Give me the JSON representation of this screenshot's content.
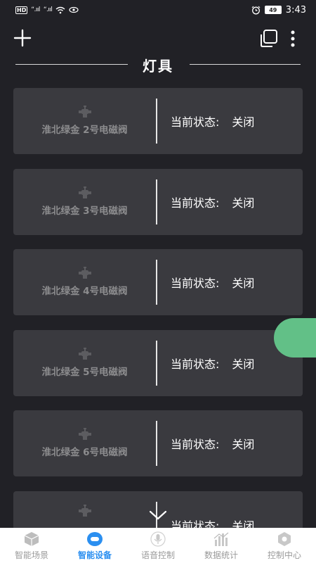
{
  "status_bar": {
    "hd_label": "HD",
    "sim1": "“.ııl",
    "sim2": "“.ııl",
    "battery": "49",
    "time": "3:43"
  },
  "header": {
    "section_title": "灯具"
  },
  "devices": [
    {
      "name": "淮北绿金 2号电磁阀",
      "status_label": "当前状态:",
      "status_value": "关闭"
    },
    {
      "name": "淮北绿金 3号电磁阀",
      "status_label": "当前状态:",
      "status_value": "关闭"
    },
    {
      "name": "淮北绿金 4号电磁阀",
      "status_label": "当前状态:",
      "status_value": "关闭"
    },
    {
      "name": "淮北绿金 5号电磁阀",
      "status_label": "当前状态:",
      "status_value": "关闭"
    },
    {
      "name": "淮北绿金 6号电磁阀",
      "status_label": "当前状态:",
      "status_value": "关闭"
    },
    {
      "name": "",
      "status_label": "当前状态:",
      "status_value": "关闭"
    }
  ],
  "bottom_nav": [
    {
      "label": "智能场景",
      "icon": "cube-icon",
      "active": false
    },
    {
      "label": "智能设备",
      "icon": "device-icon",
      "active": true
    },
    {
      "label": "语音控制",
      "icon": "microphone-icon",
      "active": false
    },
    {
      "label": "数据统计",
      "icon": "chart-icon",
      "active": false
    },
    {
      "label": "控制中心",
      "icon": "hexagon-icon",
      "active": false
    }
  ],
  "colors": {
    "background": "#212126",
    "card": "#3a3a3f",
    "accent": "#2b8ff0",
    "fab": "#62c087"
  }
}
